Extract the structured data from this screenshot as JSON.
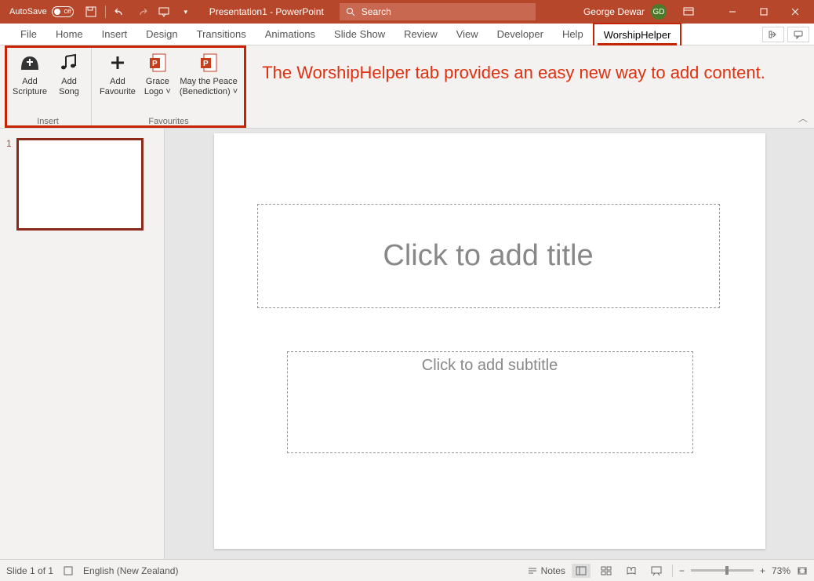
{
  "title": {
    "autosave": "AutoSave",
    "toggle": "Off",
    "doc": "Presentation1 - PowerPoint",
    "search_placeholder": "Search",
    "user": "George Dewar",
    "initials": "GD"
  },
  "tabs": [
    "File",
    "Home",
    "Insert",
    "Design",
    "Transitions",
    "Animations",
    "Slide Show",
    "Review",
    "View",
    "Developer",
    "Help",
    "WorshipHelper"
  ],
  "ribbon": {
    "groups": [
      {
        "label": "Insert",
        "buttons": [
          {
            "l1": "Add",
            "l2": "Scripture"
          },
          {
            "l1": "Add",
            "l2": "Song"
          }
        ]
      },
      {
        "label": "Favourites",
        "buttons": [
          {
            "l1": "Add",
            "l2": "Favourite"
          },
          {
            "l1": "Grace",
            "l2": "Logo ˅"
          },
          {
            "l1": "May the Peace",
            "l2": "(Benediction) ˅"
          }
        ]
      }
    ],
    "annotation": "The WorshipHelper tab provides an easy new way to add content."
  },
  "slide": {
    "num": "1",
    "title_ph": "Click to add title",
    "sub_ph": "Click to add subtitle"
  },
  "status": {
    "slide": "Slide 1 of 1",
    "lang": "English (New Zealand)",
    "notes": "Notes",
    "zoom": "73%"
  }
}
